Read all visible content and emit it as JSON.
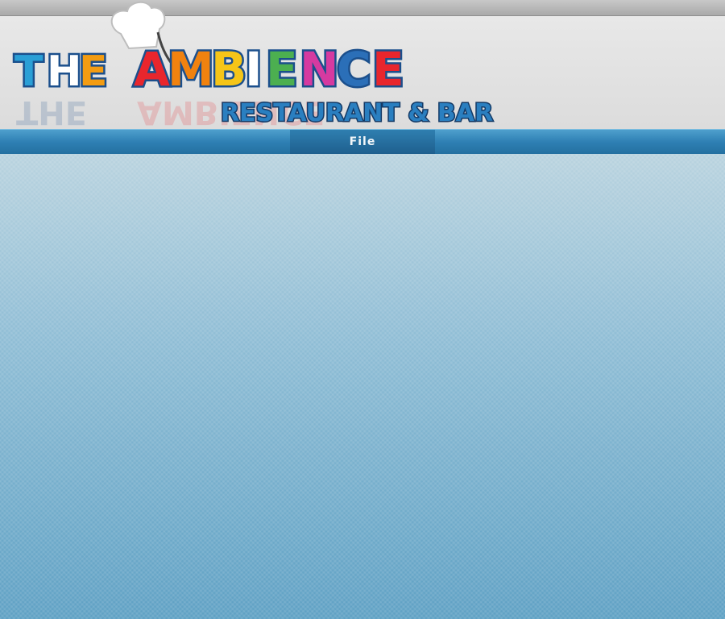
{
  "brand": {
    "word_the": "THE",
    "word_main": "AMBIENCE",
    "tagline": "RESTAURANT & BAR",
    "letter_colors": {
      "T": "#2a9fd6",
      "H": "#ffffff",
      "E1": "#f39c12",
      "A": "#e8262d",
      "M": "#f0820f",
      "B": "#f5c518",
      "I": "#ffffff",
      "E2": "#4caf50",
      "N": "#d63aa0",
      "C": "#2b6fb8",
      "E3": "#e8262d"
    },
    "outline_color": "#1b4f8c",
    "hat_icon": "chef-hat-icon"
  },
  "nav": {
    "items": [
      {
        "label": "File"
      }
    ]
  },
  "colors": {
    "nav_blue": "#2e7fb3",
    "content_top": "#b9d3df",
    "content_bottom": "#5fa1c4"
  }
}
